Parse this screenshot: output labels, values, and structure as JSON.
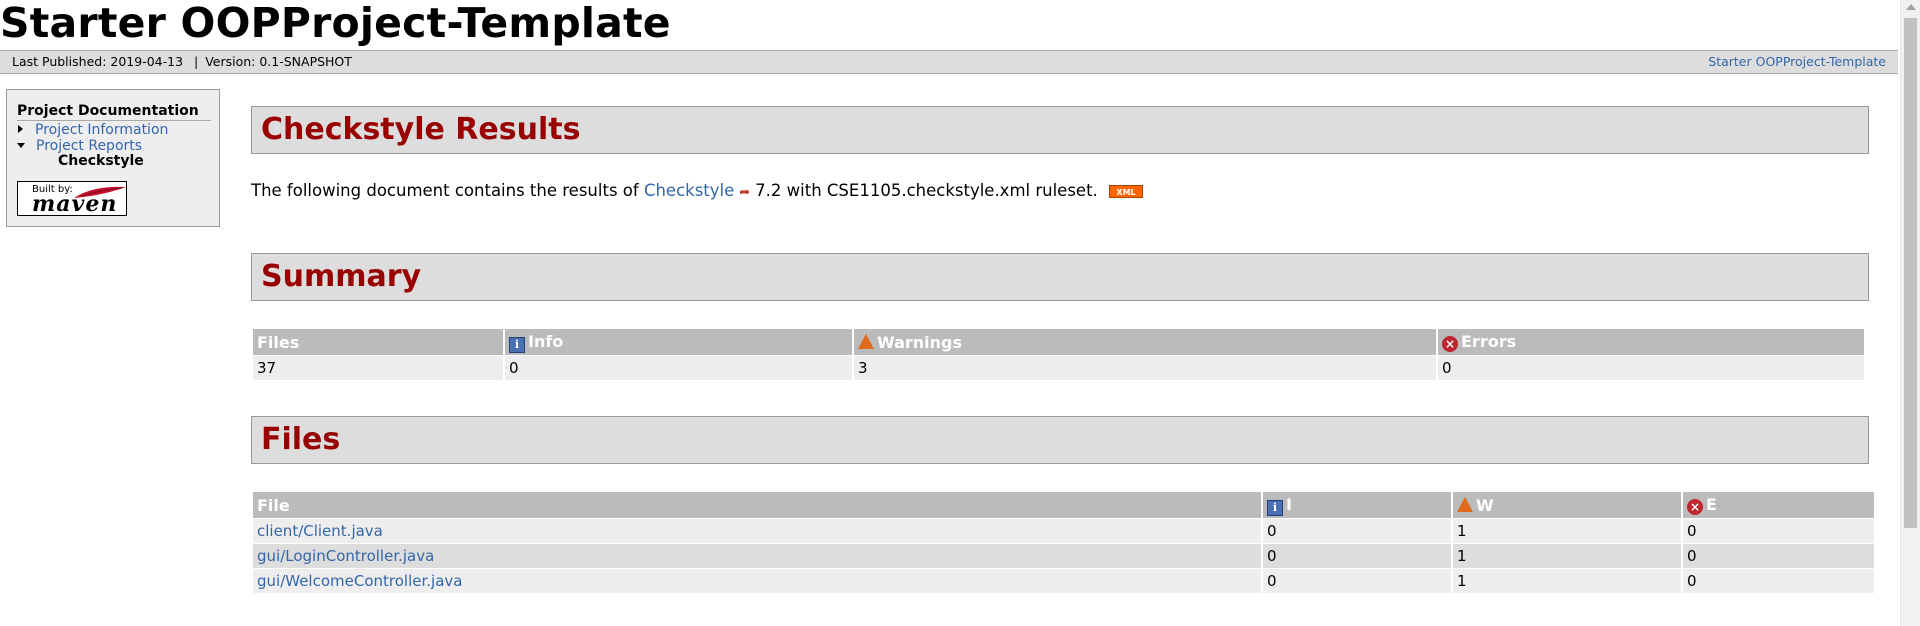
{
  "banner": {
    "title": "Starter OOPProject-Template"
  },
  "breadcrumbs": {
    "published": "Last Published: 2019-04-13",
    "separator": "|",
    "version": "Version: 0.1-SNAPSHOT",
    "project_link": "Starter OOPProject-Template"
  },
  "nav": {
    "heading": "Project Documentation",
    "items": [
      {
        "label": "Project Information"
      },
      {
        "label": "Project Reports"
      }
    ],
    "sub_active": "Checkstyle",
    "badge": {
      "built_by": "Built by:",
      "word": "maven"
    }
  },
  "main": {
    "title": "Checkstyle Results",
    "intro_before": "The following document contains the results of",
    "intro_link": "Checkstyle",
    "intro_after": "7.2 with CSE1105.checkstyle.xml ruleset.",
    "xml_badge": "XML",
    "summary_title": "Summary",
    "summary_headers": {
      "files": "Files",
      "info": "Info",
      "warnings": "Warnings",
      "errors": "Errors"
    },
    "summary_values": {
      "files": "37",
      "info": "0",
      "warnings": "3",
      "errors": "0"
    },
    "files_title": "Files",
    "files_headers": {
      "file": "File",
      "i": "I",
      "w": "W",
      "e": "E"
    },
    "files": [
      {
        "name": "client/Client.java",
        "i": "0",
        "w": "1",
        "e": "0"
      },
      {
        "name": "gui/LoginController.java",
        "i": "0",
        "w": "1",
        "e": "0"
      },
      {
        "name": "gui/WelcomeController.java",
        "i": "0",
        "w": "1",
        "e": "0"
      }
    ]
  },
  "icons": {
    "info": "info-icon",
    "warning": "warning-icon",
    "error": "error-icon",
    "external": "external-link-icon"
  },
  "colors": {
    "section_title": "#990000",
    "link": "#3366aa",
    "header_bg": "#bbbbbb",
    "section_bg": "#dddddd"
  }
}
